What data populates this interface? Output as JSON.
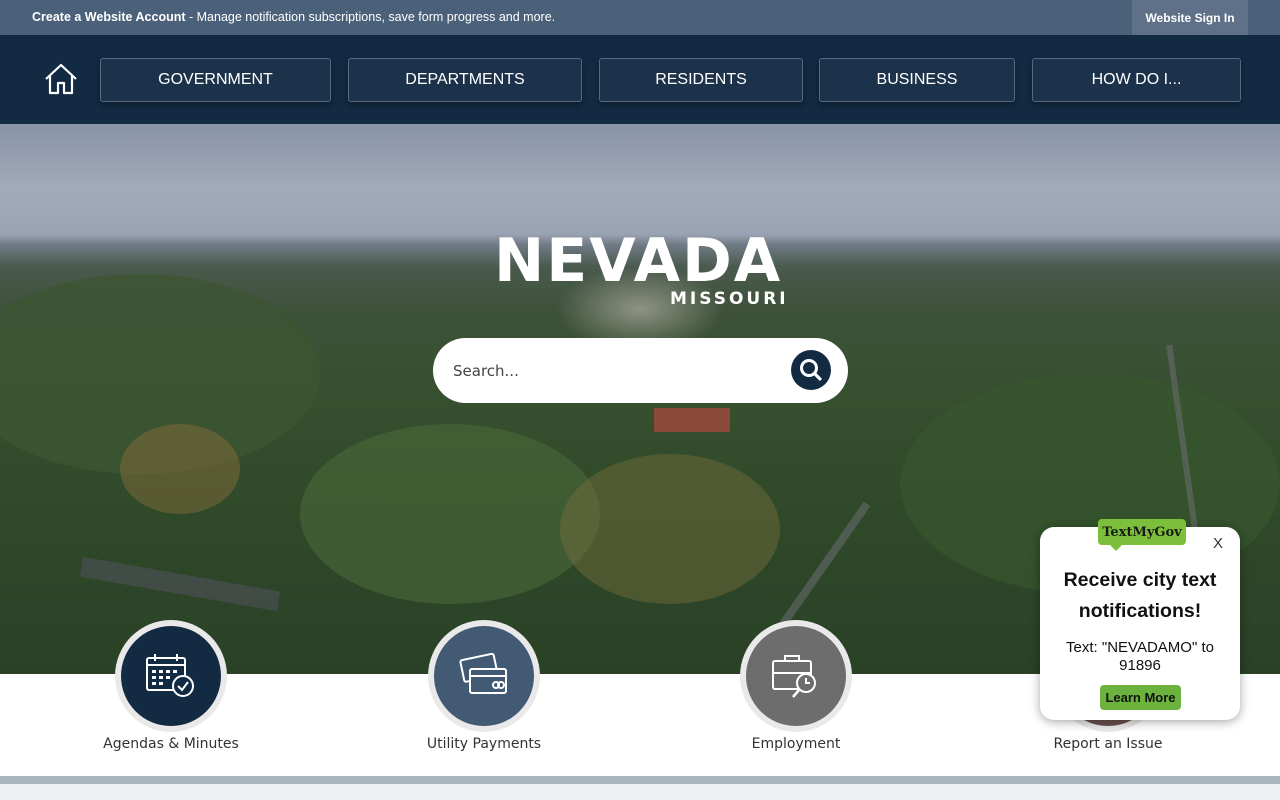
{
  "topbar": {
    "create_account": "Create a Website Account",
    "message": " - Manage notification subscriptions, save form progress and more.",
    "sign_in": "Website Sign In"
  },
  "nav": {
    "home_icon": "home-icon",
    "items": [
      {
        "label": "GOVERNMENT"
      },
      {
        "label": "DEPARTMENTS"
      },
      {
        "label": "RESIDENTS"
      },
      {
        "label": "BUSINESS"
      },
      {
        "label": "HOW DO I..."
      }
    ]
  },
  "hero": {
    "title": "NEVADA",
    "subtitle": "MISSOURI",
    "search_placeholder": "Search...",
    "search_icon": "search-icon"
  },
  "quick_links": [
    {
      "label": "Agendas & Minutes",
      "icon": "calendar-check-icon",
      "color": "#132a43"
    },
    {
      "label": "Utility Payments",
      "icon": "credit-card-icon",
      "color": "#435a75"
    },
    {
      "label": "Employment",
      "icon": "briefcase-search-icon",
      "color": "#6d6d6d"
    },
    {
      "label": "Report an Issue",
      "icon": "report-issue-icon",
      "color": "#6b4f4f"
    }
  ],
  "popup": {
    "badge": "TextMyGov",
    "close": "X",
    "title": "Receive city text notifications!",
    "text": "Text: \"NEVADAMO\" to 91896",
    "learn_more": "Learn More"
  },
  "colors": {
    "nav_bg": "#132a43",
    "topbar_bg": "#4b6079",
    "popup_green": "#6cb33e"
  }
}
